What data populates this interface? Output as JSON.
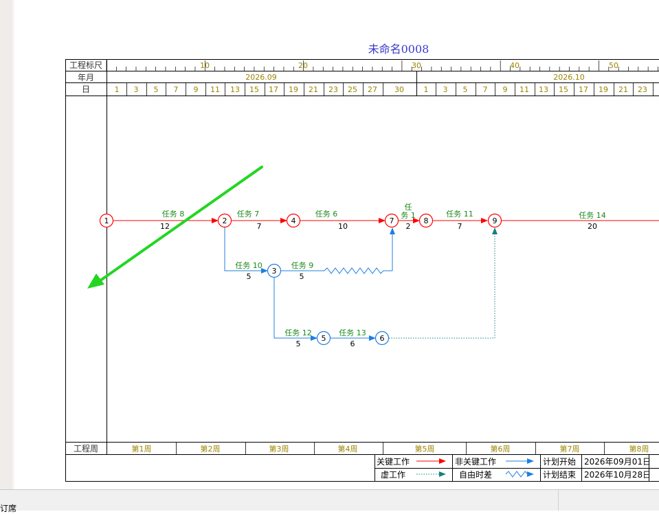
{
  "title": "未命名0008",
  "row_labels": {
    "scale": "工程标尺",
    "yearmonth": "年月",
    "day": "日",
    "week": "工程周"
  },
  "scale_ticks": [
    "10",
    "20",
    "30",
    "40",
    "50"
  ],
  "months": [
    "2026.09",
    "2026.10"
  ],
  "days": [
    "1",
    "3",
    "5",
    "7",
    "9",
    "11",
    "13",
    "15",
    "17",
    "19",
    "21",
    "23",
    "25",
    "27",
    "30",
    "1",
    "3",
    "5",
    "7",
    "9",
    "11",
    "13",
    "15",
    "17",
    "19",
    "21",
    "23"
  ],
  "weeks": [
    "第1周",
    "第2周",
    "第3周",
    "第4周",
    "第5周",
    "第6周",
    "第7周",
    "第8周"
  ],
  "nodes": [
    "1",
    "2",
    "3",
    "4",
    "5",
    "6",
    "7",
    "8",
    "9"
  ],
  "tasks": [
    {
      "name": "任务 8",
      "duration": "12"
    },
    {
      "name": "任务 7",
      "duration": "7"
    },
    {
      "name": "任务 6",
      "duration": "10"
    },
    {
      "name": "任务 1",
      "name_line1": "任",
      "name_line2": "务 1",
      "duration": "2"
    },
    {
      "name": "任务 11",
      "duration": "7"
    },
    {
      "name": "任务 14",
      "duration": "20"
    },
    {
      "name": "任务 10",
      "duration": "5"
    },
    {
      "name": "任务 9",
      "duration": "5"
    },
    {
      "name": "任务 12",
      "duration": "5"
    },
    {
      "name": "任务 13",
      "duration": "6"
    }
  ],
  "legend": {
    "critical": "关键工作",
    "noncritical": "非关键工作",
    "dummy": "虚工作",
    "free_float": "自由时差",
    "plan_start_label": "计划开始",
    "plan_start_value": "2026年09月01日",
    "plan_end_label": "计划结束",
    "plan_end_value": "2026年10月28日"
  },
  "status": {
    "left_text": "订席"
  },
  "colors": {
    "critical": "#ff0000",
    "noncritical": "#1f7fe0",
    "dummy": "#148080",
    "task_text": "#1a8a1a",
    "title": "#3a3ad0",
    "annotation_arrow": "#22d622"
  }
}
